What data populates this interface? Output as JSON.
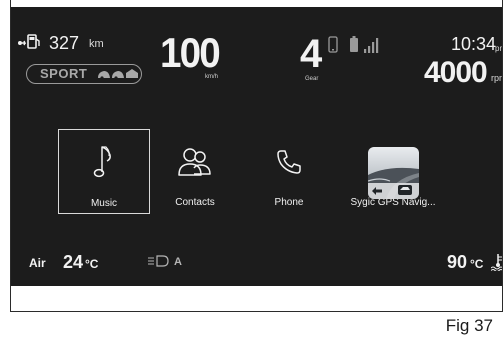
{
  "status": {
    "range_value": "327",
    "range_unit": "km",
    "drive_mode": "SPORT",
    "speed_value": "100",
    "speed_unit": "km/h",
    "gear_value": "4",
    "gear_label": "Gear",
    "clock_time": "10:34",
    "clock_ampm": "pm",
    "rpm_value": "4000",
    "rpm_unit": "rpm"
  },
  "apps": [
    {
      "label": "Music",
      "icon": "music-note-icon",
      "selected": true
    },
    {
      "label": "Contacts",
      "icon": "contacts-icon",
      "selected": false
    },
    {
      "label": "Phone",
      "icon": "phone-handset-icon",
      "selected": false
    },
    {
      "label": "Sygic GPS Navig...",
      "icon": "sygic-gps-app-icon",
      "selected": false
    }
  ],
  "climate": {
    "air_label": "Air",
    "air_temp": "24",
    "air_unit": "°C",
    "fan_mode": "A",
    "coolant_temp": "90",
    "coolant_unit": "°C"
  },
  "figure_label": "Fig 37",
  "colors": {
    "screen_bg": "#1c1c1c",
    "text": "#f2f2f2",
    "muted": "#a8a8a8"
  }
}
